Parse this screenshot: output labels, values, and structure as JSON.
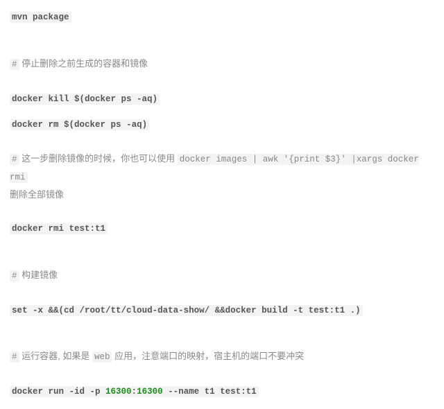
{
  "l1": "mvn package",
  "c1_hash": "#",
  "c1_txt": " 停止删除之前生成的容器和镜像",
  "l2_a": "docker kill $(docker ",
  "l2_b": "ps",
  "l2_c": " -aq)",
  "l3_a": "docker ",
  "l3_b": "rm",
  "l3_c": " $(docker ",
  "l3_d": "ps",
  "l3_e": " -aq)",
  "c2_hash": "#",
  "c2_txt1": " 这一步删除镜像的时候，你也可以使用 ",
  "c2_code": "docker images | awk '{print $3}' |xargs docker rmi",
  "c2_txt2": "删除全部镜像",
  "l4": "docker rmi ",
  "l4b": "test",
  "l4c": ":t1",
  "c3_hash": "#",
  "c3_txt": " 构建镜像",
  "l5_a": "set",
  "l5_b": " -x &&(",
  "l5_c": "cd",
  "l5_d": " /root/tt/cloud-data-show/ &&docker build -t ",
  "l5_e": "test",
  "l5_f": ":t1 .)",
  "c4_hash": "#",
  "c4_txt1": " 运行容器, 如果是 ",
  "c4_code": "web",
  "c4_txt2": " 应用，注意端口的映射，宿主机的端口不要冲突",
  "l6_a": "docker run -id -p ",
  "l6_b": "16300",
  "l6_c": ":",
  "l6_d": "16300",
  "l6_e": " --name t1 ",
  "l6_f": "test",
  "l6_g": ":t1"
}
